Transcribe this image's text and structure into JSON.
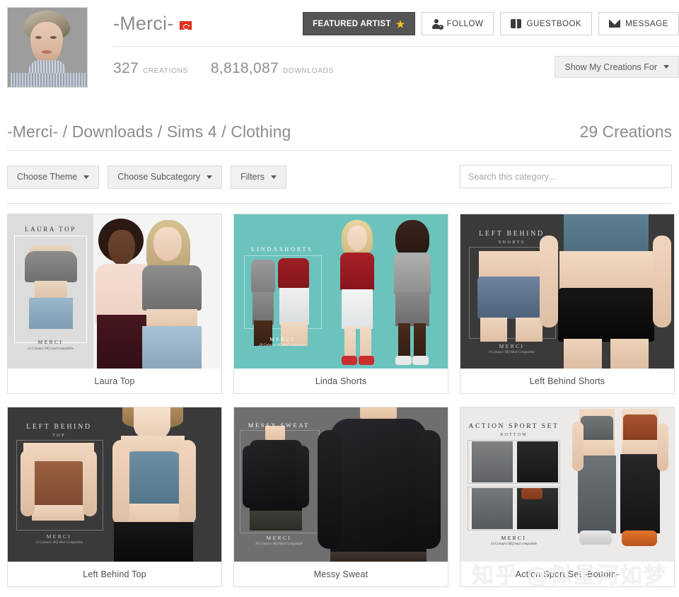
{
  "profile": {
    "user_name": "-Merci-",
    "flag": "turkey-flag",
    "avatar_alt": "merci-avatar",
    "buttons": [
      {
        "label": "FEATURED ARTIST",
        "icon": "star-icon",
        "name": "featured-artist-badge",
        "featured": true
      },
      {
        "label": "FOLLOW",
        "icon": "person-add-icon",
        "name": "follow-button",
        "featured": false
      },
      {
        "label": "GUESTBOOK",
        "icon": "book-icon",
        "name": "guestbook-button",
        "featured": false
      },
      {
        "label": "MESSAGE",
        "icon": "mail-icon",
        "name": "message-button",
        "featured": false
      }
    ],
    "stats": [
      {
        "value": "327",
        "label": "CREATIONS"
      },
      {
        "value": "8,818,087",
        "label": "DOWNLOADS"
      }
    ],
    "show_creations_label": "Show My Creations For"
  },
  "breadcrumb": {
    "text": "-Merci- / Downloads / Sims 4 / Clothing",
    "count": "29 Creations"
  },
  "filters": {
    "theme_label": "Choose Theme",
    "subcategory_label": "Choose Subcategory",
    "filters_label": "Filters",
    "search_placeholder": "Search this category...",
    "search_value": ""
  },
  "creations": [
    {
      "title": "Laura Top",
      "promo_title": "LAURA TOP",
      "promo_sub": "",
      "promo_brand": "MERCI",
      "promo_colours": "14 Colours/ HQ mod compatible",
      "bg_color": "#f4f4f4",
      "panel_color": "#dcdcdc",
      "text_color": "#3a3a3a"
    },
    {
      "title": "Linda Shorts",
      "promo_title": "LINDASHORTS",
      "promo_sub": "",
      "promo_brand": "MERCI",
      "promo_colours": "20 Colours/ HQ mod compatible",
      "bg_color": "#6cc3bd",
      "panel_color": "#6cc3bd",
      "text_color": "#ffffff"
    },
    {
      "title": "Left Behind Shorts",
      "promo_title": "LEFT BEHIND",
      "promo_sub": "SHORTS",
      "promo_brand": "MERCI",
      "promo_colours": "8 Colours/ HQ Mod Compatible",
      "bg_color": "#3a3a3a",
      "panel_color": "#3a3a3a",
      "text_color": "#d8d8d8"
    },
    {
      "title": "Left Behind Top",
      "promo_title": "LEFT BEHIND",
      "promo_sub": "TOP",
      "promo_brand": "MERCI",
      "promo_colours": "12 Colours/ HQ Mod Compatible",
      "bg_color": "#3a3a3a",
      "panel_color": "#3a3a3a",
      "text_color": "#d8d8d8"
    },
    {
      "title": "Messy Sweat",
      "promo_title": "MESSY SWEAT",
      "promo_sub": "",
      "promo_brand": "MERCI",
      "promo_colours": "10 Colours/ HQ Mod Compatible",
      "bg_color": "#6f6f6f",
      "panel_color": "#7a7a7a",
      "text_color": "#ffffff"
    },
    {
      "title": "Action Sport Set -Bottom-",
      "promo_title": "ACTION SPORT SET",
      "promo_sub": "BOTTOM",
      "promo_brand": "MERCI",
      "promo_colours": "14 Colours/ HQ mod compatible",
      "bg_color": "#eceae8",
      "panel_color": "#eceae8",
      "text_color": "#2e2e2e"
    }
  ],
  "watermark": {
    "text": "知乎 @似星河如梦"
  }
}
